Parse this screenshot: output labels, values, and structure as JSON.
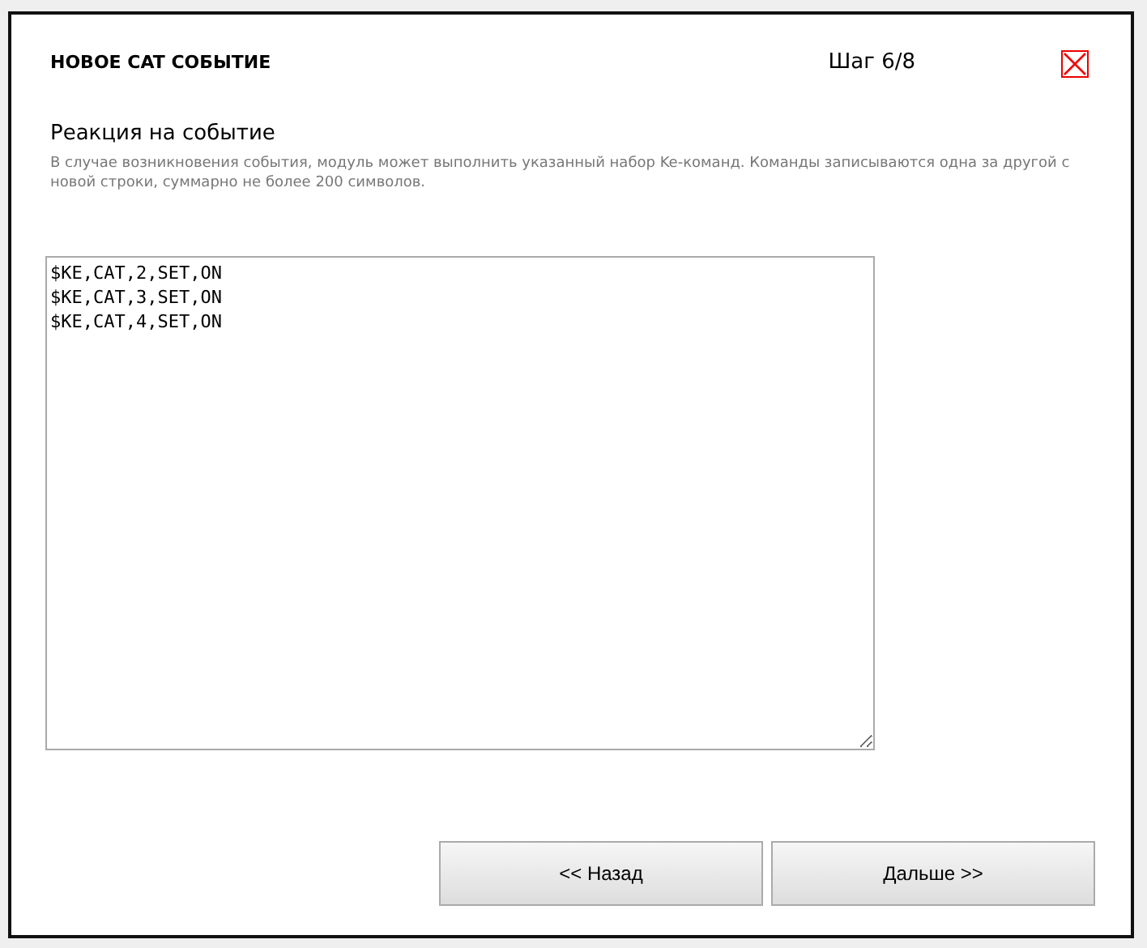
{
  "dialog": {
    "title": "НОВОЕ CAT СОБЫТИЕ",
    "step": "Шаг 6/8"
  },
  "section": {
    "heading": "Реакция на событие",
    "description": "В случае возникновения события, модуль может выполнить указанный набор Ke-команд. Команды записываются одна за другой с новой строки, суммарно не более 200 символов."
  },
  "commands": {
    "lines": [
      "$KE,CAT,2,SET,ON",
      "$KE,CAT,3,SET,ON",
      "$KE,CAT,4,SET,ON"
    ]
  },
  "buttons": [
    {
      "label": "<< Назад"
    },
    {
      "label": "Дальше >>"
    }
  ]
}
